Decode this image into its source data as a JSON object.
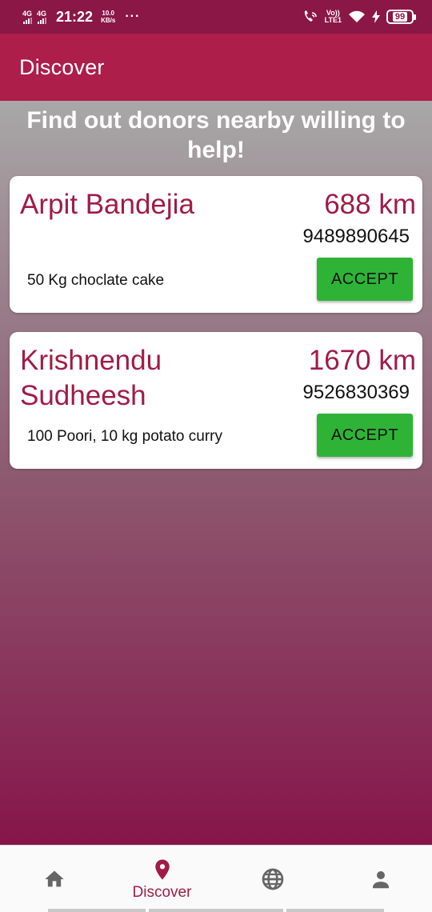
{
  "status_bar": {
    "sim1": "4G",
    "sim2": "4G",
    "time": "21:22",
    "speed_value": "10.0",
    "speed_unit": "KB/s",
    "overflow": "···",
    "volte_top": "Vo))",
    "volte_bottom": "LTE1",
    "battery": "99"
  },
  "app_bar": {
    "title": "Discover"
  },
  "headline": "Find out donors nearby willing to help!",
  "donors": [
    {
      "name": "Arpit Bandejia",
      "distance": "688 km",
      "phone": "9489890645",
      "description": "50 Kg choclate cake",
      "action_label": "ACCEPT"
    },
    {
      "name": "Krishnendu Sudheesh",
      "distance": "1670 km",
      "phone": "9526830369",
      "description": "100 Poori, 10 kg potato curry",
      "action_label": "ACCEPT"
    }
  ],
  "bottom_nav": {
    "items": [
      {
        "icon": "home-icon",
        "label": ""
      },
      {
        "icon": "location-pin-icon",
        "label": "Discover",
        "active": true
      },
      {
        "icon": "globe-icon",
        "label": ""
      },
      {
        "icon": "person-icon",
        "label": ""
      }
    ]
  },
  "colors": {
    "status_bar": "#8b1746",
    "app_bar": "#ad1e4a",
    "accent_text": "#a01c46",
    "accept_button": "#2fb336"
  }
}
